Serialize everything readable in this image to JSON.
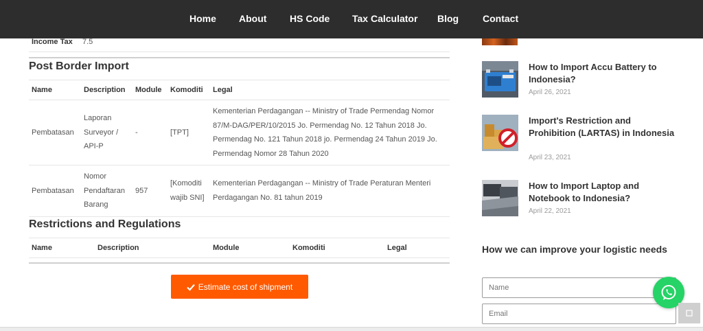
{
  "nav": {
    "items": [
      "Home",
      "About",
      "HS Code",
      "Tax Calculator",
      "Blog",
      "Contact"
    ]
  },
  "tax": {
    "label": "Income Tax",
    "value": "7.5"
  },
  "post_border": {
    "title": "Post Border Import",
    "headers": [
      "Name",
      "Description",
      "Module",
      "Komoditi",
      "Legal"
    ],
    "rows": [
      {
        "name": "Pembatasan",
        "description": "Laporan Surveyor / API-P",
        "module": "-",
        "komoditi": "[TPT]",
        "legal": "Kementerian Perdagangan -- Ministry of Trade Permendag Nomor 87/M-DAG/PER/10/2015 Jo. Permendag No. 12 Tahun 2018 Jo. Permendag No. 121 Tahun 2018 jo. Permendag 24 Tahun 2019 Jo. Permendag Nomor 28 Tahun 2020"
      },
      {
        "name": "Pembatasan",
        "description": "Nomor Pendaftaran Barang",
        "module": "957",
        "komoditi": "[Komoditi wajib SNI]",
        "legal": "Kementerian Perdagangan -- Ministry of Trade Peraturan Menteri Perdagangan No. 81 tahun 2019"
      }
    ]
  },
  "restrictions": {
    "title": "Restrictions and Regulations",
    "headers": [
      "Name",
      "Description",
      "Module",
      "Komoditi",
      "Legal"
    ]
  },
  "estimate_button": {
    "label": "Estimate cost of shipment",
    "icon": "check-icon"
  },
  "sidebar": {
    "posts": [
      {
        "title": "How to Import Accu Battery to Indonesia?",
        "date": "April 26, 2021"
      },
      {
        "title": "Import's Restriction and Prohibition (LARTAS) in Indonesia",
        "date": "April 23, 2021"
      },
      {
        "title": "How to Import Laptop and Notebook to Indonesia?",
        "date": "April 22, 2021"
      }
    ],
    "form": {
      "title": "How we can improve your logistic needs",
      "name_placeholder": "Name",
      "email_placeholder": "Email"
    }
  },
  "colors": {
    "accent": "#ff5a00",
    "nav_bg": "#2d2d2d",
    "whatsapp": "#25d366"
  }
}
